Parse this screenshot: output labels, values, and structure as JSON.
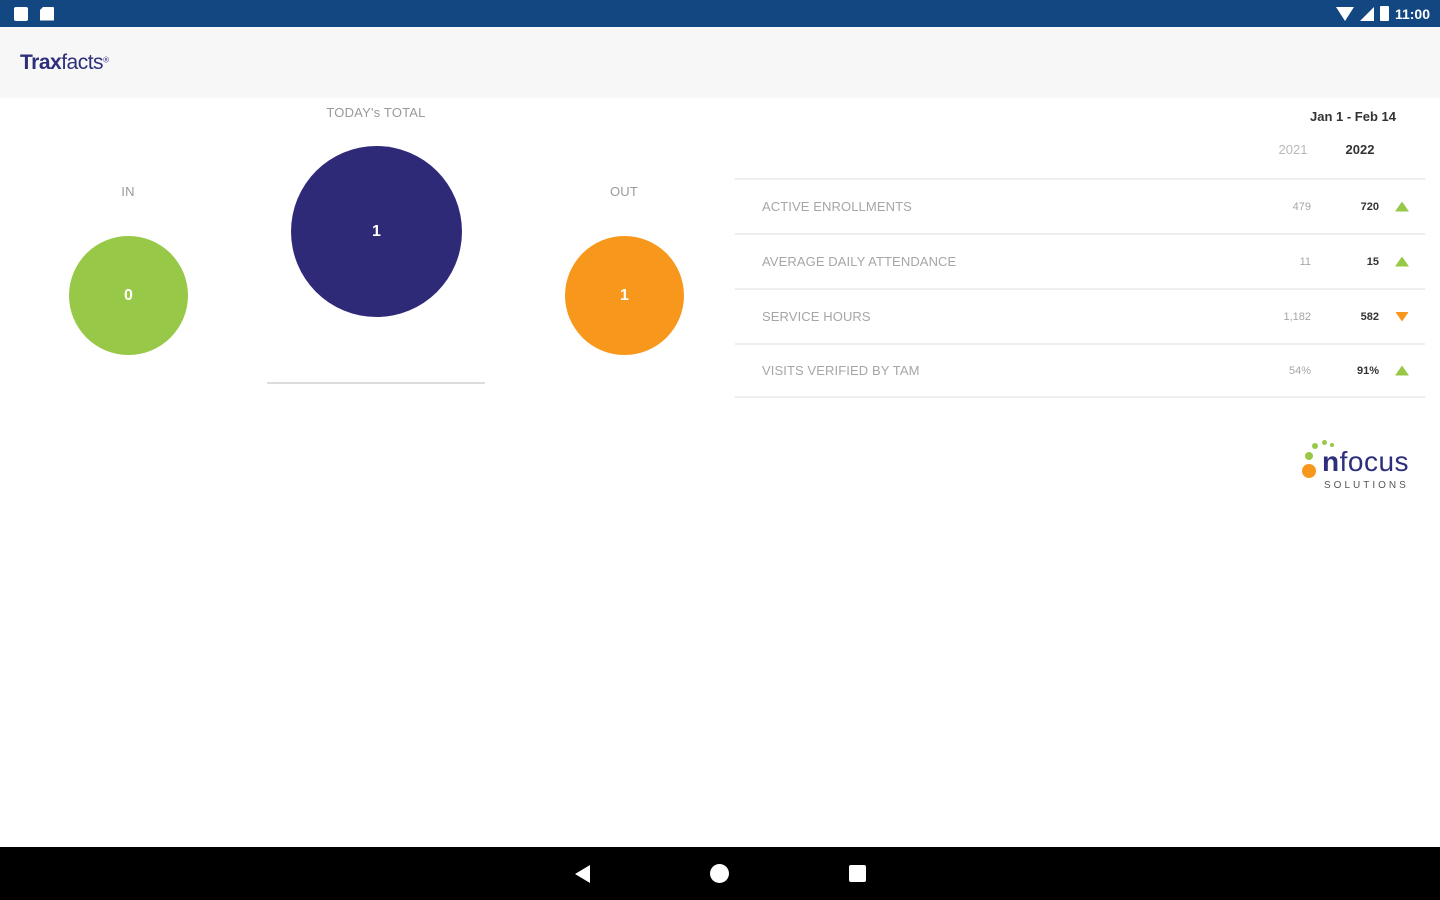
{
  "status_bar": {
    "time": "11:00"
  },
  "app": {
    "logo_trax": "Trax",
    "logo_facts": "facts"
  },
  "summary": {
    "in_label": "IN",
    "in_value": "0",
    "total_label": "TODAY's TOTAL",
    "total_value": "1",
    "out_label": "OUT",
    "out_value": "1"
  },
  "stats": {
    "date_range": "Jan 1 - Feb 14",
    "year_prev": "2021",
    "year_curr": "2022",
    "rows": [
      {
        "label": "ACTIVE ENROLLMENTS",
        "prev": "479",
        "curr": "720",
        "trend": "up"
      },
      {
        "label": "AVERAGE DAILY ATTENDANCE",
        "prev": "11",
        "curr": "15",
        "trend": "up"
      },
      {
        "label": "SERVICE HOURS",
        "prev": "1,182",
        "curr": "582",
        "trend": "down"
      },
      {
        "label": "VISITS VERIFIED BY TAM",
        "prev": "54%",
        "curr": "91%",
        "trend": "up"
      }
    ]
  },
  "brand": {
    "nfocus_n": "n",
    "nfocus_rest": "focus",
    "nfocus_sub": "SOLUTIONS"
  },
  "colors": {
    "in": "#97c847",
    "total": "#2e2a78",
    "out": "#f7981d",
    "status_bar": "#124782"
  }
}
